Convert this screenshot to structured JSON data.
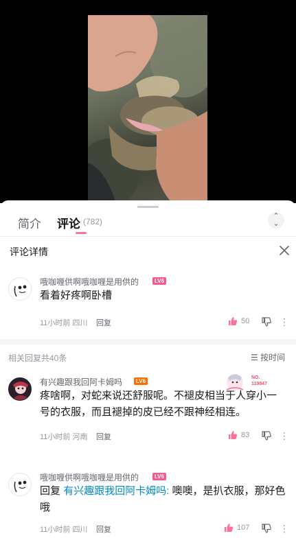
{
  "panel": {
    "tabs": [
      {
        "label": "简介"
      },
      {
        "label": "评论",
        "count": "(782)"
      }
    ],
    "details_title": "评论详情",
    "main_comment": {
      "username": "哦咖喱供啊哦咖喱是用供的",
      "level": "LV6",
      "text": "看着好疼啊卧槽",
      "time_location": "11小时前 四川",
      "reply_label": "回复",
      "likes": "50"
    },
    "replies_header": {
      "count_label": "相关回复共40条",
      "sort_label": "按时间"
    },
    "replies": [
      {
        "username": "有兴趣跟我回阿卡姆吗",
        "level": "LV6",
        "text": "疼啥啊，对蛇来说还舒服呢。不褪皮相当于人穿小一号的衣服，而且褪掉的皮已经不跟神经相连。",
        "time_location": "11小时前 河南",
        "reply_label": "回复",
        "likes": "83",
        "fan_number": "NO.\n119847"
      },
      {
        "username": "哦咖喱供啊哦咖喱是用供的",
        "level": "LV6",
        "reply_prefix": "回复",
        "reply_target": "有兴趣跟我回阿卡姆吗:",
        "text": "噢噢，是扒衣服，那好色哦",
        "time_location": "11小时前 四川",
        "reply_label": "回复",
        "likes": "107"
      }
    ]
  },
  "colors": {
    "accent_pink": "#fb7299",
    "level_badge": "#f45a8d",
    "reply_link": "#008ac5"
  }
}
